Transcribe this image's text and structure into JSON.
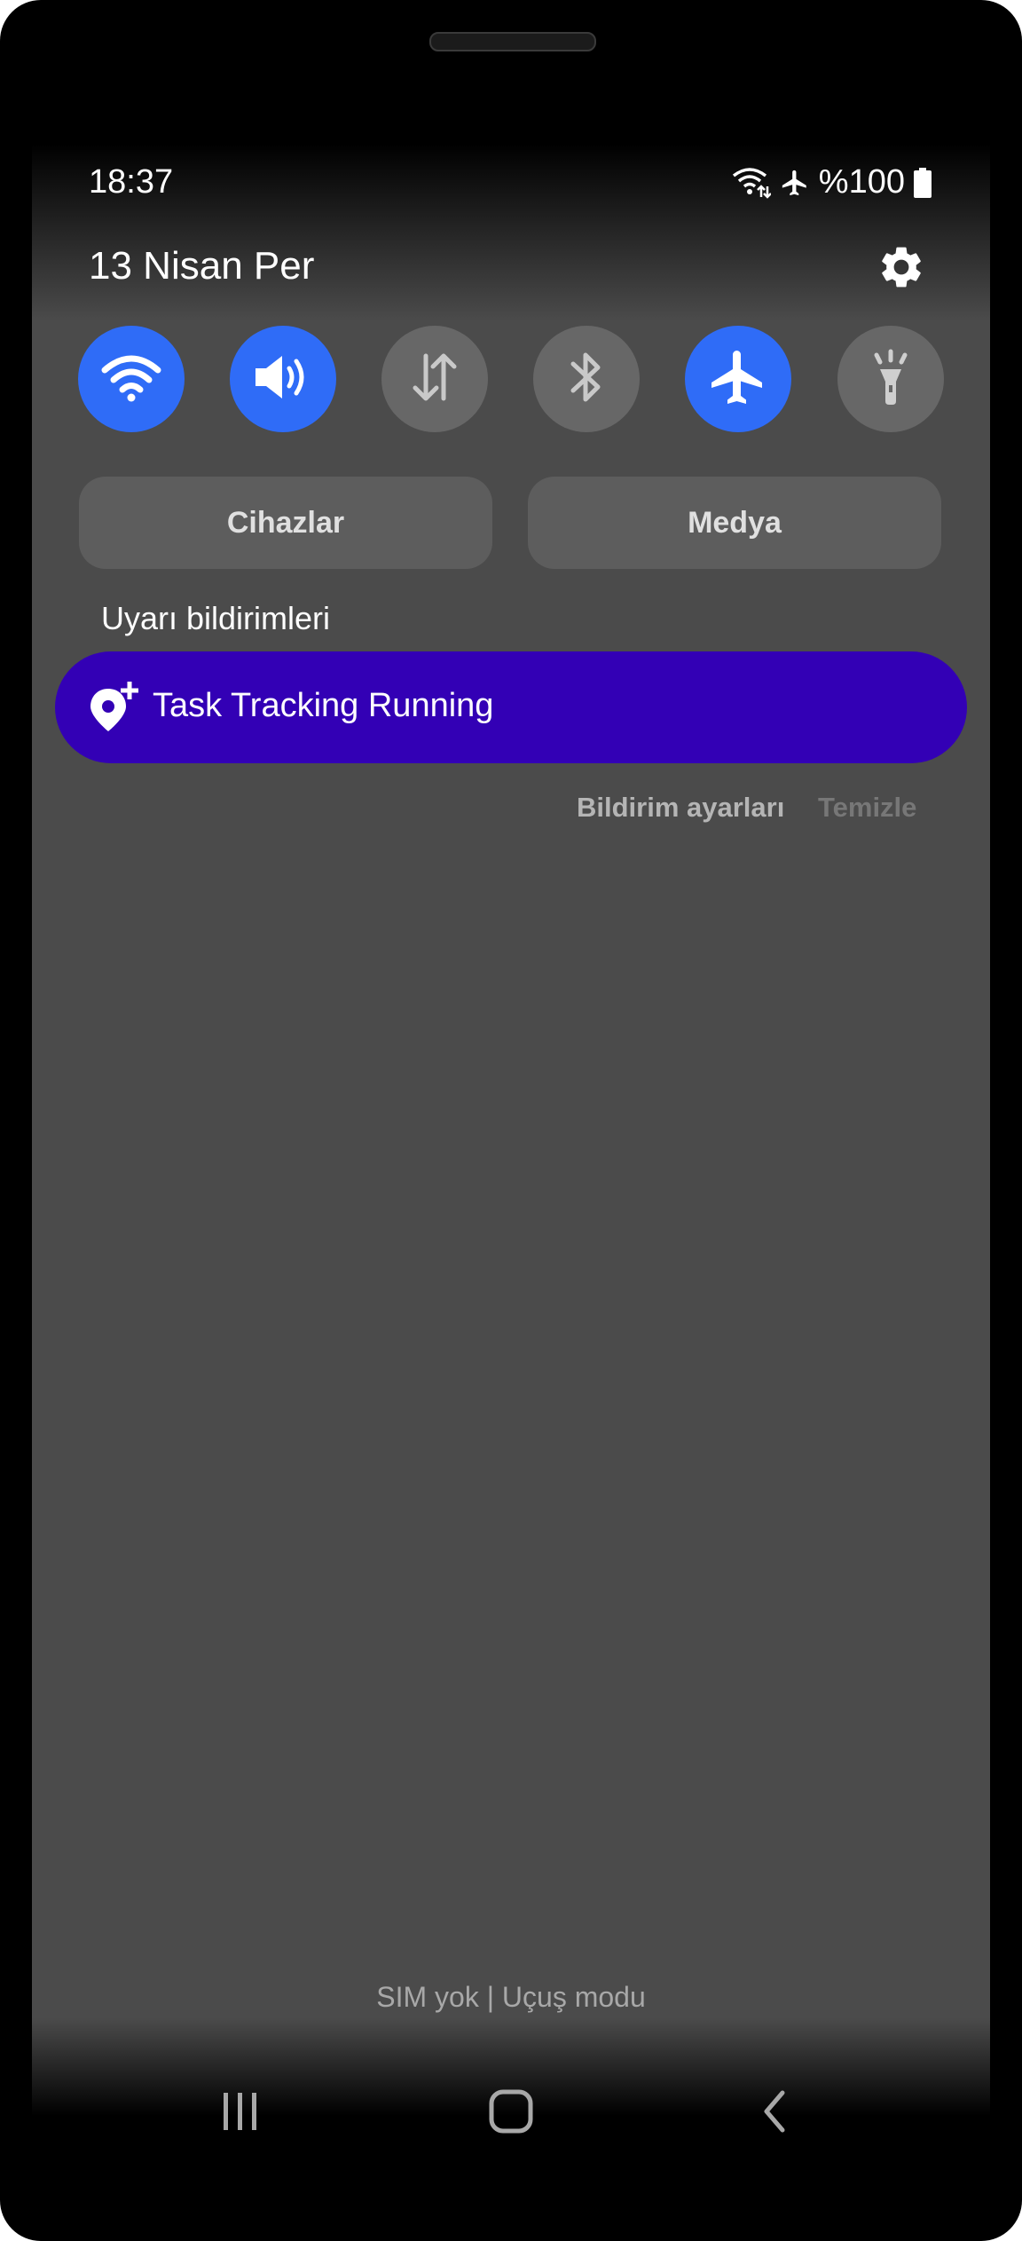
{
  "status_bar": {
    "time": "18:37",
    "battery_text": "%100",
    "icons": [
      "wifi-calling-icon",
      "airplane-mode-icon",
      "battery-icon"
    ]
  },
  "header": {
    "date": "13 Nisan Per",
    "settings_icon": "gear-icon"
  },
  "quick_toggles": [
    {
      "name": "wifi",
      "icon": "wifi-icon",
      "state": "on"
    },
    {
      "name": "sound",
      "icon": "volume-icon",
      "state": "on"
    },
    {
      "name": "mobile-data",
      "icon": "data-transfer-icon",
      "state": "off"
    },
    {
      "name": "bluetooth",
      "icon": "bluetooth-icon",
      "state": "off"
    },
    {
      "name": "airplane-mode",
      "icon": "airplane-icon",
      "state": "on"
    },
    {
      "name": "flashlight",
      "icon": "flashlight-icon",
      "state": "off"
    }
  ],
  "panel_buttons": {
    "devices": "Cihazlar",
    "media": "Medya"
  },
  "notifications": {
    "section_title": "Uyarı bildirimleri",
    "items": [
      {
        "icon": "location-add-icon",
        "title": "Task Tracking Running",
        "color": "#3300b5"
      }
    ],
    "settings_label": "Bildirim ayarları",
    "clear_label": "Temizle"
  },
  "footer": {
    "carrier": "SIM yok | Uçuş modu"
  },
  "nav_bar": {
    "icons": [
      "recent-apps-icon",
      "home-icon",
      "back-icon"
    ]
  },
  "colors": {
    "toggle_on": "#2f6cf7",
    "toggle_off": "#676767",
    "panel_bg": "#4b4b4b",
    "notification_bg": "#3300b5"
  }
}
